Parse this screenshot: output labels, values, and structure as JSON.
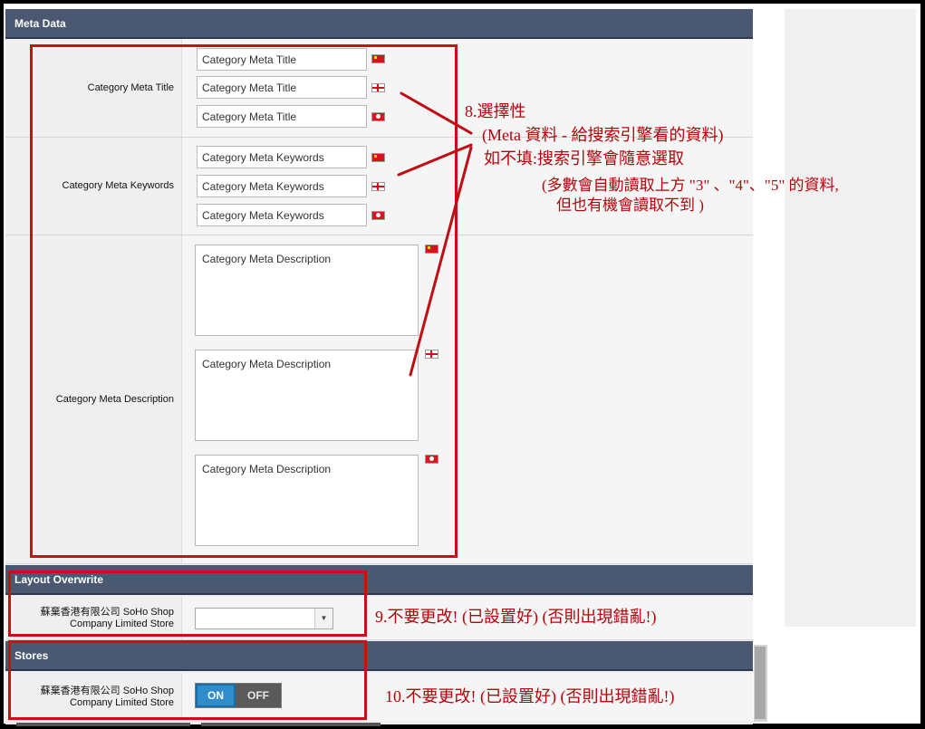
{
  "meta_section": {
    "title": "Meta Data",
    "meta_title": {
      "label": "Category Meta Title",
      "fields": [
        "Category Meta Title",
        "Category Meta Title",
        "Category Meta Title"
      ]
    },
    "meta_keywords": {
      "label": "Category Meta Keywords",
      "fields": [
        "Category Meta Keywords",
        "Category Meta Keywords",
        "Category Meta Keywords"
      ]
    },
    "meta_description": {
      "label": "Category Meta Description",
      "fields": [
        "Category Meta Description",
        "Category Meta Description",
        "Category Meta Description"
      ]
    }
  },
  "flags": [
    "china-flag-icon",
    "uk-flag-icon",
    "hong-kong-flag-icon"
  ],
  "layout_section": {
    "title": "Layout Overwrite",
    "store_label_line1": "蘇棄香港有限公司 SoHo Shop",
    "store_label_line2": "Company Limited Store",
    "select_value": ""
  },
  "stores_section": {
    "title": "Stores",
    "store_label_line1": "蘇棄香港有限公司 SoHo Shop",
    "store_label_line2": "Company Limited Store",
    "toggle_on": "ON",
    "toggle_off": "OFF",
    "toggle_state": "on"
  },
  "annotations": {
    "note8_line1": "8.選擇性",
    "note8_line2": "(Meta 資料 - 給搜索引擎看的資料)",
    "note8_line3": "如不填:搜索引擎會隨意選取",
    "note8_line4": "(多數會自動讀取上方 \"3\" 、\"4\"、\"5\" 的資料,",
    "note8_line5": "但也有機會讀取不到 )",
    "note9": "9.不要更改! (已設置好) (否則出現錯亂!)",
    "note10": "10.不要更改! (已設置好) (否則出現錯亂!)"
  },
  "colors": {
    "section_bar": "#4a5872",
    "annotation_red": "#cc0d15",
    "toggle_on": "#2f8dcd",
    "toggle_off": "#5a5a5a"
  }
}
